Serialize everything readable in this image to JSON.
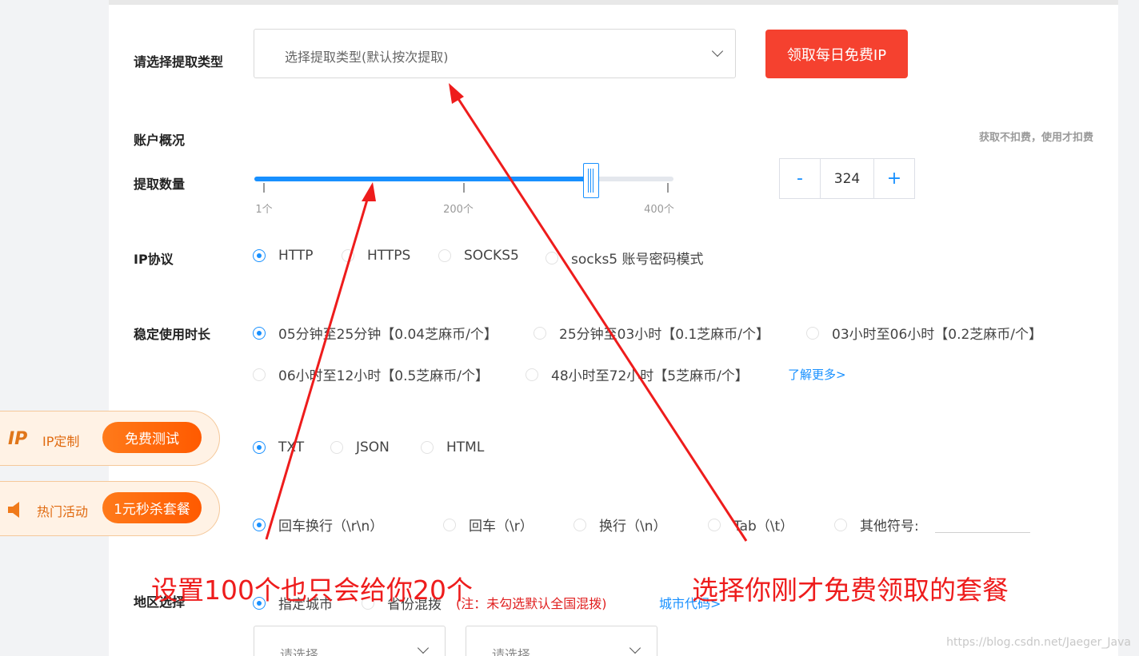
{
  "extract_type": {
    "label": "请选择提取类型",
    "placeholder": "选择提取类型(默认按次提取)"
  },
  "free_ip_button": "领取每日免费IP",
  "account": {
    "label": "账户概况",
    "hint": "获取不扣费，使用才扣费"
  },
  "quantity": {
    "label": "提取数量",
    "value": "324",
    "min_label": "1个",
    "mid_label": "200个",
    "max_label": "400个",
    "min": 1,
    "max": 400,
    "current": 324,
    "minus": "-",
    "plus": "+"
  },
  "protocol": {
    "label": "IP协议",
    "options": [
      "HTTP",
      "HTTPS",
      "SOCKS5",
      "socks5 账号密码模式"
    ],
    "selected": 0
  },
  "duration": {
    "label": "稳定使用时长",
    "options": [
      "05分钟至25分钟【0.04芝麻币/个】",
      "25分钟至03小时【0.1芝麻币/个】",
      "03小时至06小时【0.2芝麻币/个】",
      "06小时至12小时【0.5芝麻币/个】",
      "48小时至72小时【5芝麻币/个】"
    ],
    "selected": 0,
    "more_link": "了解更多>"
  },
  "format": {
    "options": [
      "TXT",
      "JSON",
      "HTML"
    ],
    "selected": 0
  },
  "separator": {
    "options": [
      "回车换行（\\r\\n）",
      "回车（\\r）",
      "换行（\\n）",
      "Tab（\\t）",
      "其他符号:"
    ],
    "selected": 0
  },
  "region": {
    "label": "地区选择",
    "options": [
      "指定城市",
      "省份混拨"
    ],
    "selected": 0,
    "note": "(注：未勾选默认全国混拨)",
    "city_code_link": "城市代码>",
    "select1_placeholder": "请选择",
    "select2_placeholder": "请选择"
  },
  "float_ip": {
    "logo": "IP",
    "label": "IP定制",
    "button": "免费测试"
  },
  "float_hot": {
    "label": "热门活动",
    "button": "1元秒杀套餐"
  },
  "annotations": {
    "left": "设置100个也只会给你20个",
    "right": "选择你刚才免费领取的套餐"
  },
  "watermark": "https://blog.csdn.net/Jaeger_Java",
  "colors": {
    "accent": "#1890ff",
    "red": "#f5412f",
    "orange": "#ff6a00",
    "annotation": "#ee1c1c"
  }
}
